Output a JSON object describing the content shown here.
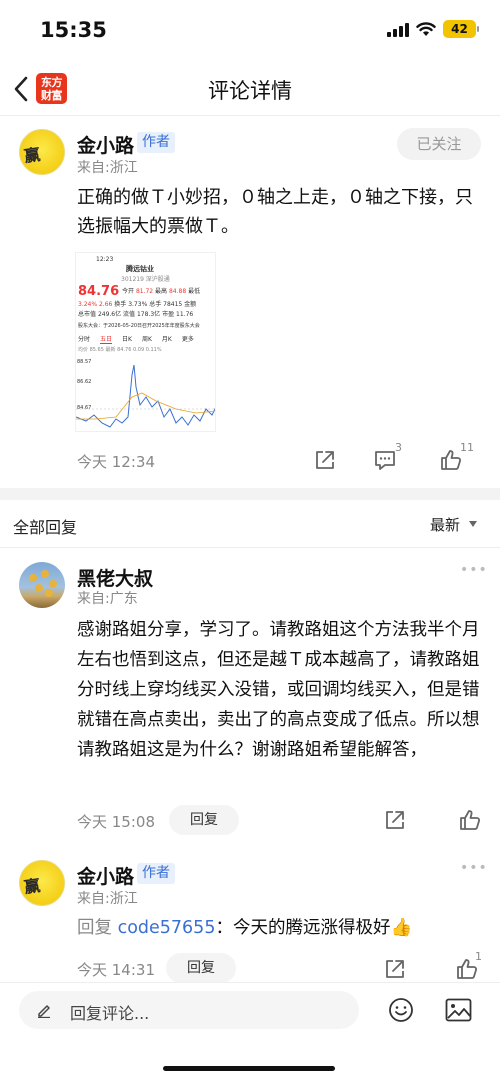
{
  "status_bar": {
    "time": "15:35",
    "battery": "42"
  },
  "nav": {
    "logo_line1": "东方",
    "logo_line2": "财富",
    "title": "评论详情"
  },
  "post": {
    "author": "金小路",
    "author_tag": "作者",
    "location": "来自:浙江",
    "follow_label": "已关注",
    "text": "正确的做Ｔ小妙招，０轴之上走，０轴之下接，只选振幅大的票做Ｔ。",
    "time": "今天 12:34",
    "comment_count": "3",
    "like_count": "11",
    "thumbnail": {
      "status_time": "12:23",
      "stock_name": "腾远钴业",
      "stock_code": "301219 深沪股通",
      "price": "84.76",
      "change": "3.24%",
      "change_abs": "2.66",
      "open_label": "今开",
      "open": "81.72",
      "high_label": "最高",
      "high": "84.88",
      "low_label": "最低",
      "turnover_label": "换手",
      "turnover": "3.73%",
      "volume_label": "总手",
      "volume": "78415",
      "amount_label": "金额",
      "market_cap_label": "总市值",
      "market_cap": "249.6亿",
      "float_label": "流值",
      "float_value": "178.3亿",
      "pe_label": "市盈",
      "pe_value": "11.76",
      "notice": "股东大会：于2026-05-20日召开2025年年度股东大会",
      "tabs": [
        "分时",
        "五日",
        "日K",
        "周K",
        "月K",
        "更多"
      ],
      "legend": "均价 85.65 最新 84.76 0.09 0.11%",
      "y_ticks": [
        "88.57",
        "86.62",
        "84.67"
      ]
    }
  },
  "comments_section": {
    "title": "全部回复",
    "sort": "最新"
  },
  "comments": [
    {
      "author": "黑佬大叔",
      "location": "来自:广东",
      "text": "感谢路姐分享，学习了。请教路姐这个方法我半个月左右也悟到这点，但还是越Ｔ成本越高了，请教路姐分时线上穿均线买入没错，或回调均线买入，但是错就错在高点卖出，卖出了的高点变成了低点。所以想请教路姐这是为什么？谢谢路姐希望能解答，",
      "time": "今天 15:08",
      "reply_label": "回复"
    },
    {
      "author": "金小路",
      "author_tag": "作者",
      "location": "来自:浙江",
      "reply_prefix": "回复",
      "reply_target": "code57655",
      "text": "：今天的腾远涨得极好👍",
      "time": "今天 14:31",
      "reply_label": "回复",
      "like_count": "1"
    }
  ],
  "bottom_bar": {
    "placeholder": "回复评论..."
  }
}
